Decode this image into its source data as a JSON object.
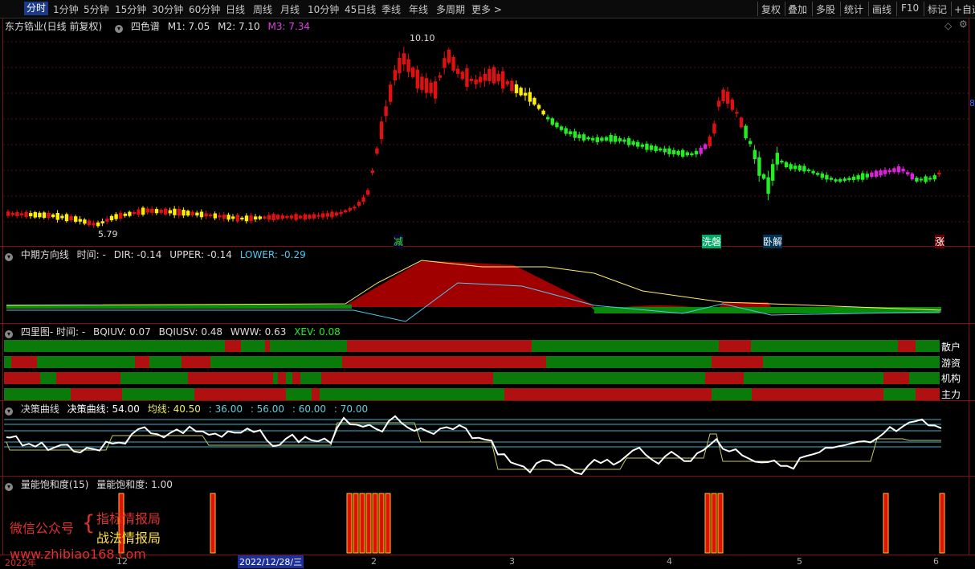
{
  "toolbar": {
    "periods": [
      "分时",
      "1分钟",
      "5分钟",
      "15分钟",
      "30分钟",
      "60分钟",
      "日线",
      "周线",
      "月线",
      "10分钟",
      "45日线",
      "季线",
      "年线",
      "多周期",
      "更多 >"
    ],
    "active_period": "分时",
    "right_buttons": [
      "复权",
      "叠加",
      "多股",
      "统计",
      "画线",
      "F10",
      "标记",
      "+自选"
    ]
  },
  "main_pane": {
    "stock_title": "东方锆业(日线 前复权)",
    "indicator": "四色谱",
    "m1": "M1: 7.05",
    "m2": "M2: 7.10",
    "m3": "M3: 7.34",
    "high_label": "10.10",
    "low_label": "5.79",
    "right_mark": "8",
    "signals": [
      "减",
      "洗磐",
      "卧解",
      "涨"
    ]
  },
  "pane2": {
    "title": "中期方向线",
    "time": "时间: -",
    "dir": "DIR: -0.14",
    "upper": "UPPER: -0.14",
    "lower": "LOWER: -0.29"
  },
  "pane3": {
    "title": "四里图- 时间: -",
    "bqiuv": "BQIUV: 0.07",
    "bqiusv": "BQIUSV: 0.48",
    "www": "WWW: 0.63",
    "xev": "XEV: 0.08",
    "rows": [
      "散户",
      "游资",
      "机构",
      "主力"
    ]
  },
  "pane4": {
    "title": "决策曲线",
    "line": "决策曲线: 54.00",
    "avg": "均线: 40.50",
    "levels": [
      ": 36.00",
      ": 56.00",
      ": 60.00",
      ": 70.00"
    ]
  },
  "pane5": {
    "title": "量能饱和度(15)",
    "value": "量能饱和度: 1.00"
  },
  "watermark": {
    "wechat": "微信公众号",
    "line1": "指标情报局",
    "line2": "战法情报局",
    "url": "www.zhibiao168.com"
  },
  "xaxis": {
    "year": "2022年",
    "ticks": [
      "12",
      "2",
      "3",
      "4",
      "5",
      "6"
    ],
    "cursor_date": "2022/12/28/三"
  },
  "colors": {
    "up_red": "#e01010",
    "down_green": "#00c000",
    "yellow": "#ffee00",
    "bright_green": "#22ee22",
    "magenta": "#e020e0",
    "stripe_red": "#b01010",
    "stripe_green": "#0a7a0a"
  }
}
